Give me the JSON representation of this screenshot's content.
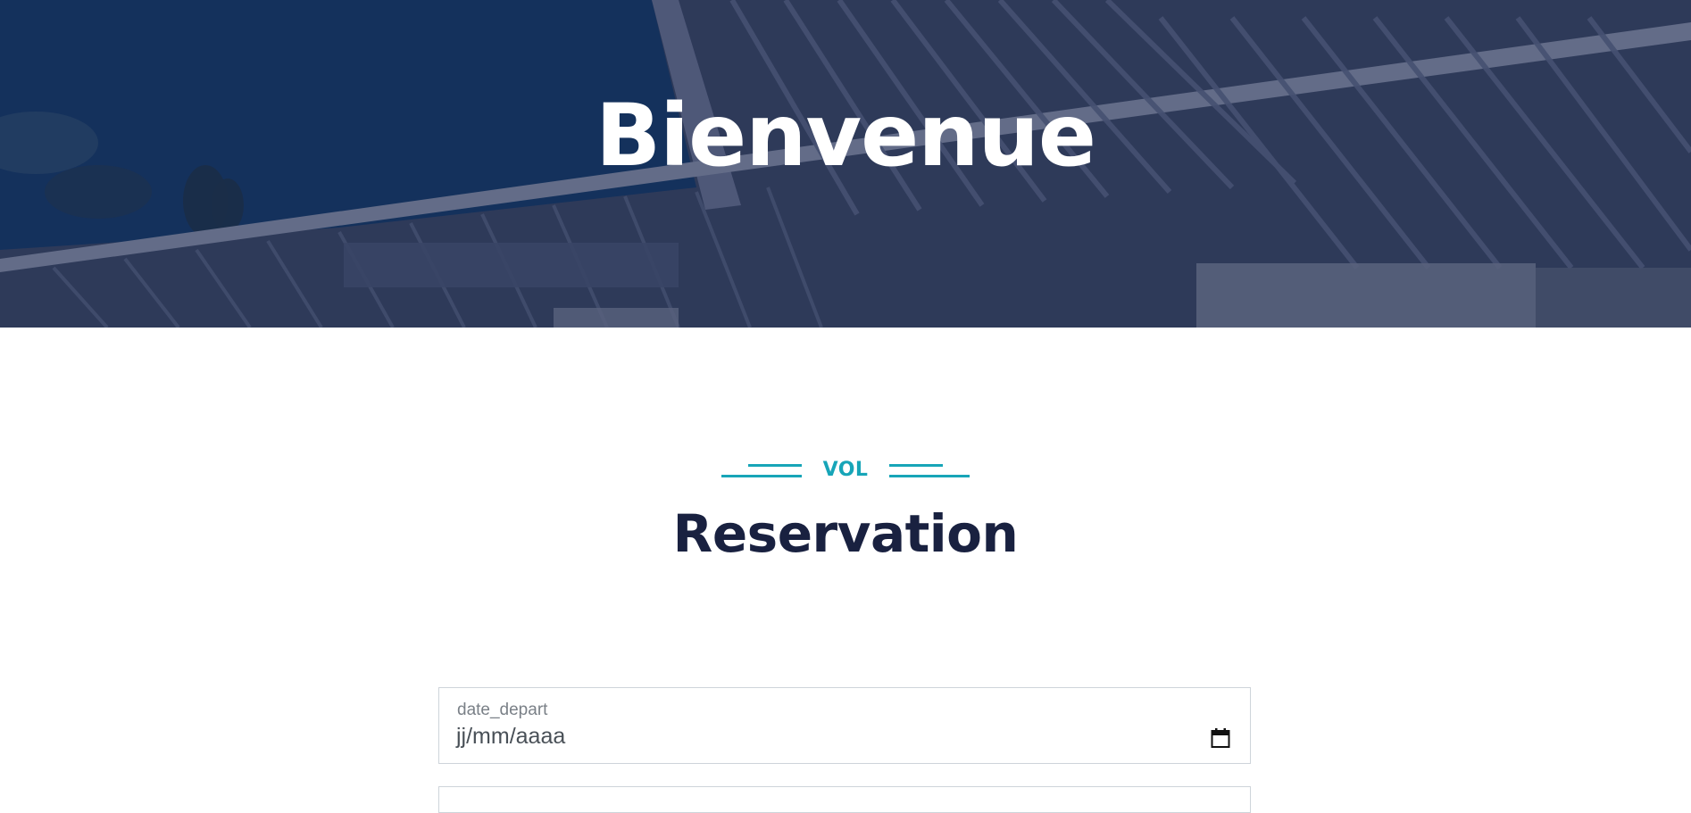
{
  "hero": {
    "title": "Bienvenue"
  },
  "section": {
    "kicker": "VOL",
    "title": "Reservation"
  },
  "form": {
    "date_depart": {
      "label": "date_depart",
      "placeholder": "jj/mm/aaaa"
    }
  },
  "icons": {
    "calendar": "calendar-icon"
  },
  "colors": {
    "hero_overlay": "#13345f",
    "accent": "#17a5b8",
    "heading": "#192140",
    "field_border": "#ced4da"
  }
}
